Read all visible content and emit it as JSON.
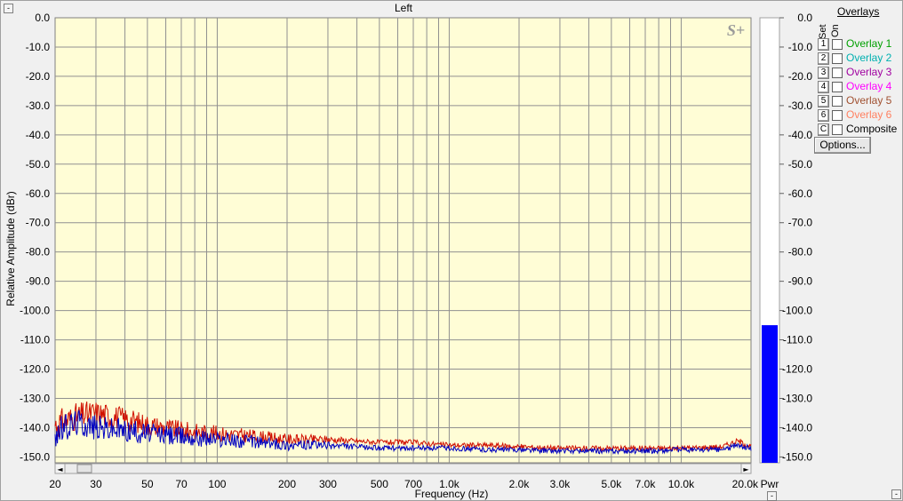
{
  "window": {
    "title": "Left",
    "collapse_glyph": "-"
  },
  "chart_data": {
    "type": "line",
    "title": "Left",
    "xlabel": "Frequency (Hz)",
    "ylabel": "Relative Amplitude (dBr)",
    "xscale": "log",
    "xlim": [
      20,
      20000
    ],
    "ylim": [
      -152,
      0
    ],
    "grid": true,
    "background": "#fffdd6",
    "watermark": "S+",
    "x_ticks": [
      "20",
      "30",
      "50",
      "70",
      "100",
      "200",
      "300",
      "500",
      "700",
      "1.0k",
      "2.0k",
      "3.0k",
      "5.0k",
      "7.0k",
      "10.0k",
      "20.0k"
    ],
    "y_ticks": [
      "0.0",
      "-10.0",
      "-20.0",
      "-30.0",
      "-40.0",
      "-50.0",
      "-60.0",
      "-70.0",
      "-80.0",
      "-90.0",
      "-100.0",
      "-110.0",
      "-120.0",
      "-130.0",
      "-140.0",
      "-150.0"
    ],
    "series": [
      {
        "color": "#d01000",
        "x": [
          20,
          25,
          30,
          40,
          50,
          70,
          100,
          150,
          200,
          300,
          500,
          700,
          1000,
          1500,
          2000,
          3000,
          5000,
          7000,
          10000,
          15000,
          17500,
          20000
        ],
        "y": [
          -139,
          -136,
          -135,
          -137,
          -139,
          -141,
          -142,
          -143,
          -144,
          -144,
          -145,
          -145,
          -146,
          -146,
          -146.5,
          -147,
          -147,
          -147,
          -147,
          -146.5,
          -144.5,
          -146.5
        ]
      },
      {
        "color": "#0000c0",
        "x": [
          20,
          25,
          30,
          40,
          50,
          70,
          100,
          150,
          200,
          300,
          500,
          700,
          1000,
          1500,
          2000,
          3000,
          5000,
          7000,
          10000,
          15000,
          17500,
          20000
        ],
        "y": [
          -142,
          -138,
          -140,
          -141,
          -142,
          -143,
          -144,
          -145,
          -146,
          -146,
          -147,
          -147,
          -147,
          -147.5,
          -147.5,
          -148,
          -148,
          -148,
          -147.5,
          -147.5,
          -146,
          -147
        ]
      }
    ],
    "meter": {
      "label": "Pwr",
      "value": -105,
      "color": "#0000ff",
      "ticks": [
        "0.0",
        "-10.0",
        "-20.0",
        "-30.0",
        "-40.0",
        "-50.0",
        "-60.0",
        "-70.0",
        "-80.0",
        "-90.0",
        "-100.0",
        "-110.0",
        "-120.0",
        "-130.0",
        "-140.0",
        "-150.0"
      ]
    }
  },
  "overlays": {
    "title": "Overlays",
    "set_label": "Set",
    "on_label": "On",
    "items": [
      {
        "num": "1",
        "label": "Overlay 1",
        "color": "#00a000"
      },
      {
        "num": "2",
        "label": "Overlay 2",
        "color": "#00b0b0"
      },
      {
        "num": "3",
        "label": "Overlay 3",
        "color": "#a000a0"
      },
      {
        "num": "4",
        "label": "Overlay 4",
        "color": "#ff00ff"
      },
      {
        "num": "5",
        "label": "Overlay 5",
        "color": "#a05030"
      },
      {
        "num": "6",
        "label": "Overlay 6",
        "color": "#ff8060"
      },
      {
        "num": "C",
        "label": "Composite",
        "color": "#000000"
      }
    ],
    "options_label": "Options..."
  },
  "scrollbar": {
    "left_arrow": "◄",
    "right_arrow": "►"
  }
}
